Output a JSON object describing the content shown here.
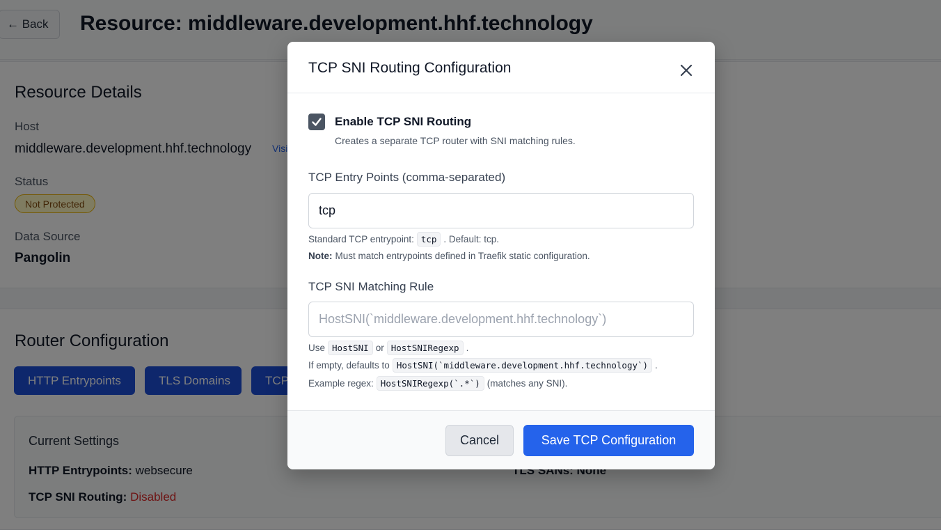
{
  "header": {
    "back_label": "← Back",
    "title": "Resource: middleware.development.hhf.technology"
  },
  "details": {
    "title": "Resource Details",
    "host_label": "Host",
    "host_value": "middleware.development.hhf.technology",
    "visit_label": "Visi",
    "status_label": "Status",
    "status_badge": "Not Protected",
    "source_label": "Data Source",
    "source_value": "Pangolin"
  },
  "router": {
    "title": "Router Configuration",
    "tabs": [
      {
        "label": "HTTP Entrypoints"
      },
      {
        "label": "TLS Domains"
      },
      {
        "label": "TCP"
      }
    ],
    "current": {
      "title": "Current Settings",
      "http_key": "HTTP Entrypoints:",
      "http_value": "websecure",
      "tcp_key": "TCP SNI Routing:",
      "tcp_value": "Disabled",
      "tls_text": "TLS SANs: None"
    }
  },
  "modal": {
    "title": "TCP SNI Routing Configuration",
    "enable_label": "Enable TCP SNI Routing",
    "enable_help": "Creates a separate TCP router with SNI matching rules.",
    "enabled": true,
    "entry_label": "TCP Entry Points (comma-separated)",
    "entry_value": "tcp",
    "entry_help_prefix": "Standard TCP entrypoint:",
    "entry_help_code": "tcp",
    "entry_help_suffix": ". Default: tcp.",
    "note_key": "Note:",
    "note_text": "Must match entrypoints defined in Traefik static configuration.",
    "rule_label": "TCP SNI Matching Rule",
    "rule_placeholder": "HostSNI(`middleware.development.hhf.technology`)",
    "rule_value": "",
    "use_prefix": "Use",
    "use_code1": "HostSNI",
    "use_or": "or",
    "use_code2": "HostSNIRegexp",
    "use_suffix": ".",
    "empty_prefix": "If empty, defaults to",
    "empty_code": "HostSNI(`middleware.development.hhf.technology`)",
    "empty_suffix": ".",
    "regex_prefix": "Example regex:",
    "regex_code": "HostSNIRegexp(`.*`)",
    "regex_suffix": "(matches any SNI).",
    "cancel_label": "Cancel",
    "save_label": "Save TCP Configuration"
  },
  "colors": {
    "primary": "#2563eb",
    "tab_blue": "#1d4ed8",
    "danger": "#dc2626",
    "warning_bg": "#fef9c3"
  }
}
